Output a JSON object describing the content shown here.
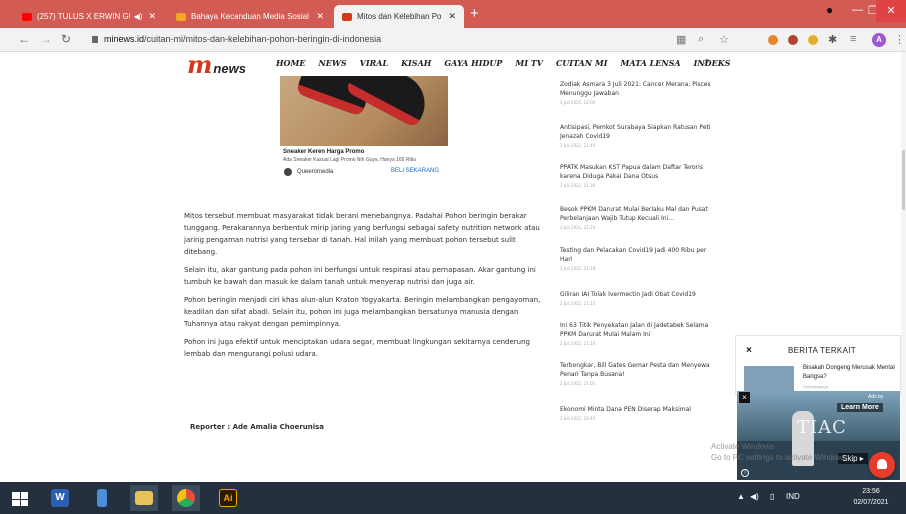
{
  "browser": {
    "tabs": [
      {
        "title": "(257) TULUS X ERWIN GUTA",
        "icon": "youtube-icon",
        "audio": "◀)"
      },
      {
        "title": "Bahaya Kecanduan Media Sosial",
        "icon": "minews-favicon"
      },
      {
        "title": "Mitos dan Kelebihan Pohon Beri",
        "icon": "minews-favicon",
        "active": true
      }
    ],
    "new_tab": "+",
    "url_host": "minews.id",
    "url_path": "/cuitan-mi/mitos-dan-kelebihan-pohon-beringin-di-indonesia",
    "profile_initial": "A"
  },
  "site": {
    "logo_m": "m",
    "logo_text": "news",
    "menu": [
      "HOME",
      "NEWS",
      "VIRAL",
      "KISAH",
      "GAYA HIDUP",
      "MI TV",
      "CUITAN MI",
      "MATA LENSA",
      "INDEKS"
    ]
  },
  "ad": {
    "title": "Sneaker Keren Harga Promo",
    "subtitle": "Ada Sneaker Kasual Lagi Promo Nih Guys, Hanya 165 Ribu",
    "brand": "Queeromedia",
    "cta": "BELI SEKARANG"
  },
  "article": {
    "paragraphs": [
      "Mitos tersebut membuat masyarakat tidak berani menebangnya. Padahal Pohon beringin berakar tunggang. Perakarannya berbentuk mirip jaring yang berfungsi sebagai safety nutrition network atau jaring pengaman nutrisi yang tersebar di tanah. Hal inilah yang membuat pohon tersebut sulit ditebang.",
      "Selain itu, akar gantung pada pohon ini berfungsi untuk respirasi atau pernapasan. Akar gantung ini tumbuh ke bawah dan masuk ke dalam tanah untuk menyerap nutrisi dan juga air.",
      "Pohon beringin menjadi ciri khas alun-alun Kraton Yogyakarta. Beringin melambangkan pengayoman, keadilan dan sifat abadi. Selain itu, pohon ini juga melambangkan bersatunya manusia dengan Tuhannya atau rakyat dengan pemimpinnya.",
      "Pohon ini juga efektif untuk menciptakan udara segar, membuat lingkungan sekitarnya cenderung lembab dan mengurangi polusi udara."
    ],
    "reporter": "Reporter : Ade Amalia Choerunisa"
  },
  "sidebar": [
    {
      "title": "Zodiak Asmara 3 Juli 2021: Cancer Merana, Pisces Menunggu Jawaban",
      "date": "3 Juli 2021, 22:00"
    },
    {
      "title": "Antisipasi, Pemkot Surabaya Siapkan Ratusan Peti Jenazah Covid19",
      "date": "2 Juli 2021, 21:40"
    },
    {
      "title": "PPATK Masukan KST Papua dalam Daftar Teroris karena Diduga Pakai Dana Otsus",
      "date": "2 Juli 2021, 21:30"
    },
    {
      "title": "Besok PPKM Darurat Mulai Berlaku Mal dan Pusat Perbelanjaan Wajib Tutup Kecuali Ini...",
      "date": "2 Juli 2021, 21:29"
    },
    {
      "title": "Testing dan Pelacakan Covid19 Jadi 400 Ribu per Hari",
      "date": "2 Juli 2021, 21:28"
    },
    {
      "title": "Giliran IAI Tolak Ivermectin Jadi Obat Covid19",
      "date": "2 Juli 2021, 21:15"
    },
    {
      "title": "Ini 63 Titik Penyekatan Jalan di Jadetabek Selama PPKM Darurat Mulai Malam Ini",
      "date": "2 Juli 2021, 21:10"
    },
    {
      "title": "Terbongkar, Bill Gates Gemar Pesta dan Menyewa Penari Tanpa Busana!",
      "date": "2 Juli 2021, 21:05"
    },
    {
      "title": "Ekonomi Minta Dana PEN Diserap Maksimal",
      "date": "2 Juli 2021, 20:45"
    }
  ],
  "related": {
    "close": "×",
    "label": "BERITA TERKAIT",
    "title": "Bisakah Dongeng Merusak Mental Bangsa?",
    "meta": "Selengkapnya"
  },
  "video_ad": {
    "ads_by": "Ads by",
    "learn_more": "Learn More",
    "skip": "Skip ▸",
    "big_text": "TIAC",
    "close": "×",
    "info": "i"
  },
  "watermark": {
    "line1": "Activate Windows",
    "line2": "Go to PC settings to activate Windows."
  },
  "taskbar": {
    "apps": [
      "word-icon",
      "file-explorer-icon",
      "folder-icon",
      "chrome-icon",
      "illustrator-icon"
    ],
    "ai_label": "Ai",
    "word_label": "W",
    "language": "IND",
    "time": "23:56",
    "date": "02/07/2021"
  },
  "colors": {
    "brand": "#d23a1c",
    "tabstrip": "#d25b53",
    "taskbar": "#24303d"
  }
}
